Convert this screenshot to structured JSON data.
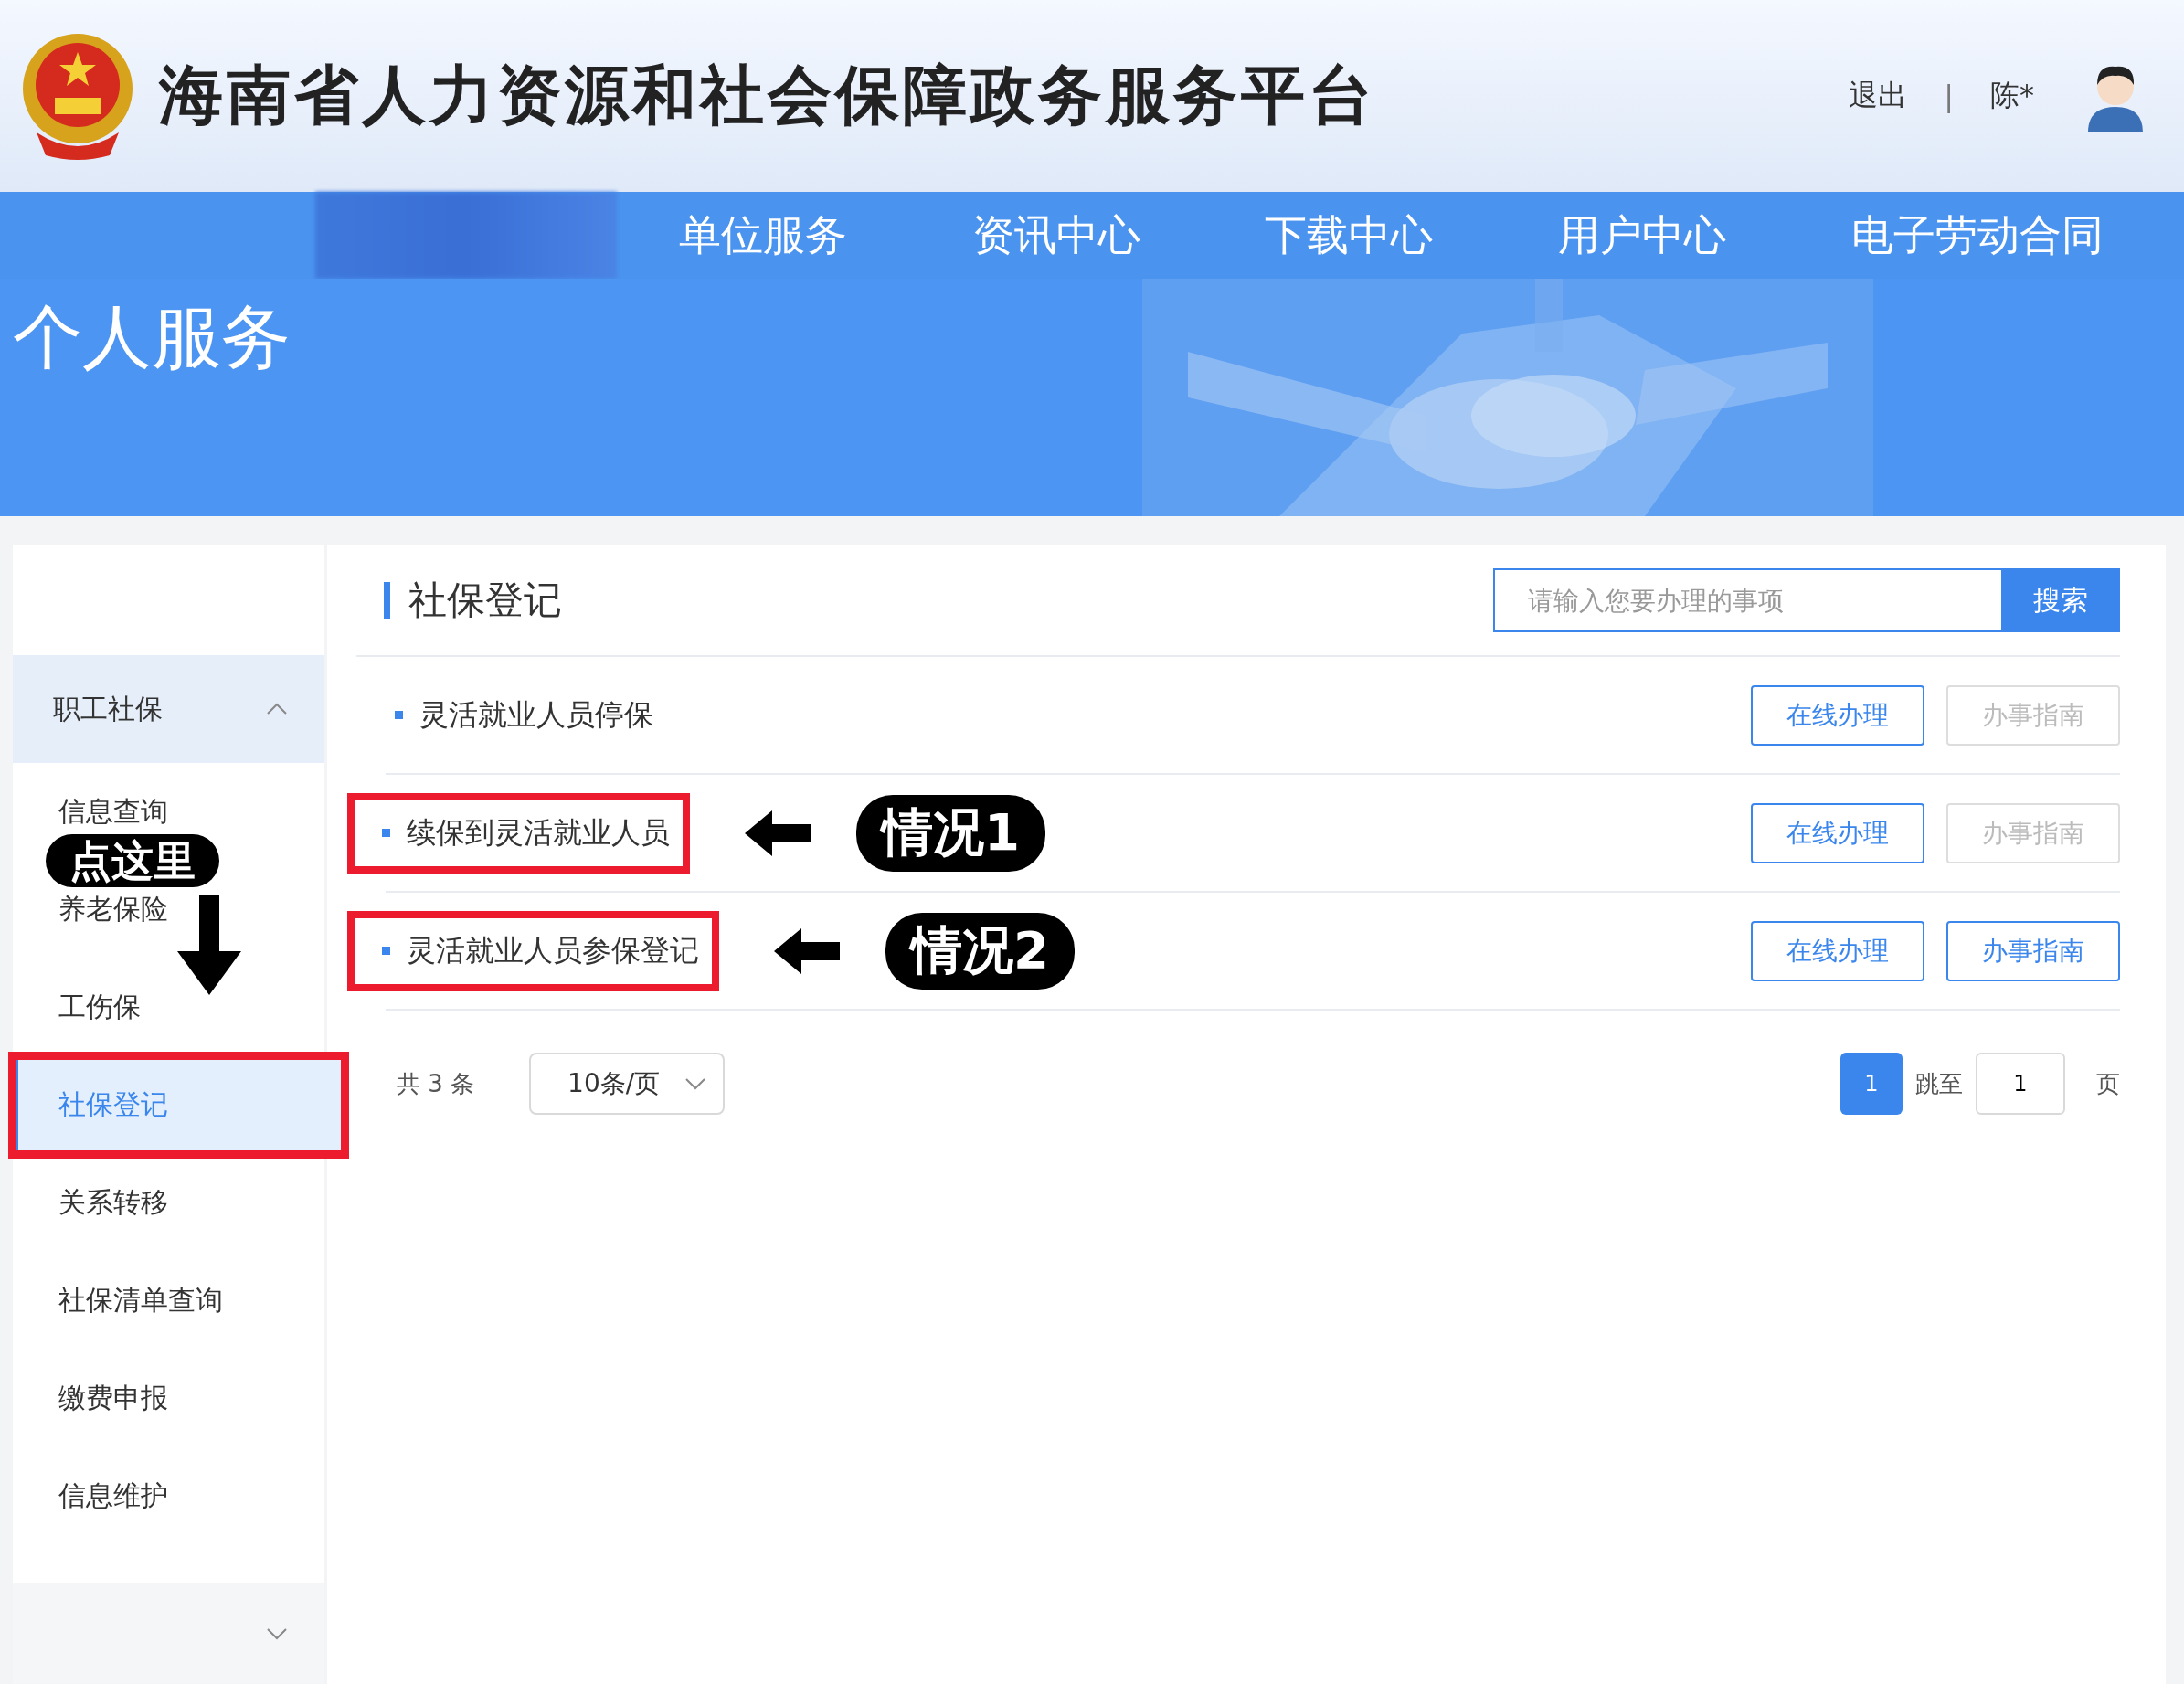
{
  "header": {
    "title": "海南省人力资源和社会保障政务服务平台",
    "logout": "退出",
    "separator": "|",
    "user": "陈*"
  },
  "nav": {
    "items": [
      {
        "label": "单位服务"
      },
      {
        "label": "资讯中心"
      },
      {
        "label": "下载中心"
      },
      {
        "label": "用户中心"
      },
      {
        "label": "电子劳动合同"
      }
    ]
  },
  "banner": {
    "title": "个人服务",
    "kind": "picture"
  },
  "sidebar": {
    "group": {
      "label": "职工社保",
      "expanded": true
    },
    "items": [
      {
        "label": "信息查询",
        "selected": false,
        "highlighted": false
      },
      {
        "label": "养老保险",
        "selected": false,
        "highlighted": false
      },
      {
        "label": "工伤保",
        "selected": false,
        "highlighted": false
      },
      {
        "label": "社保登记",
        "selected": true,
        "highlighted": true
      },
      {
        "label": "关系转移",
        "selected": false,
        "highlighted": false
      },
      {
        "label": "社保清单查询",
        "selected": false,
        "highlighted": false
      },
      {
        "label": "缴费申报",
        "selected": false,
        "highlighted": false
      },
      {
        "label": "信息维护",
        "selected": false,
        "highlighted": false
      }
    ],
    "callout": "点这里",
    "next_group": {
      "expanded": false
    }
  },
  "content": {
    "title": "社保登记",
    "search": {
      "placeholder": "请输入您要办理的事项",
      "button": "搜索"
    },
    "rows": [
      {
        "label": "灵活就业人员停保",
        "highlighted": false,
        "online": "在线办理",
        "guide": "办事指南",
        "guide_disabled": true
      },
      {
        "label": "续保到灵活就业人员",
        "highlighted": true,
        "callout": "情况1",
        "online": "在线办理",
        "guide": "办事指南",
        "guide_disabled": true
      },
      {
        "label": "灵活就业人员参保登记",
        "highlighted": true,
        "callout": "情况2",
        "online": "在线办理",
        "guide": "办事指南",
        "guide_disabled": false
      }
    ],
    "pagination": {
      "total": "共 3 条",
      "page_size": "10条/页",
      "pages": [
        {
          "label": "1",
          "selected": true
        }
      ],
      "jump_label": "跳至",
      "jump_value": "1",
      "page_unit": "页"
    }
  }
}
